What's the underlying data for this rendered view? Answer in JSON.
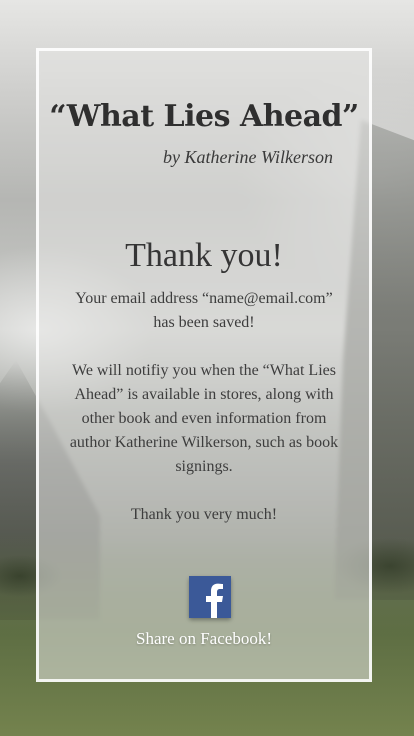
{
  "card": {
    "book_title": "“What Lies Ahead”",
    "author_line": "by Katherine Wilkerson",
    "heading": "Thank you!",
    "message_1": "Your email address “name@email.com” has been saved!",
    "message_2": "We will notifiy you when the “What Lies Ahead” is available in stores, along with other book and even information from author Katherine Wilkerson, such as book signings.",
    "message_3": "Thank you very much!",
    "share_label": "Share on Facebook!"
  },
  "icons": {
    "facebook": "facebook-icon"
  },
  "colors": {
    "facebook_blue": "#3b5998",
    "card_border": "#ffffff"
  }
}
